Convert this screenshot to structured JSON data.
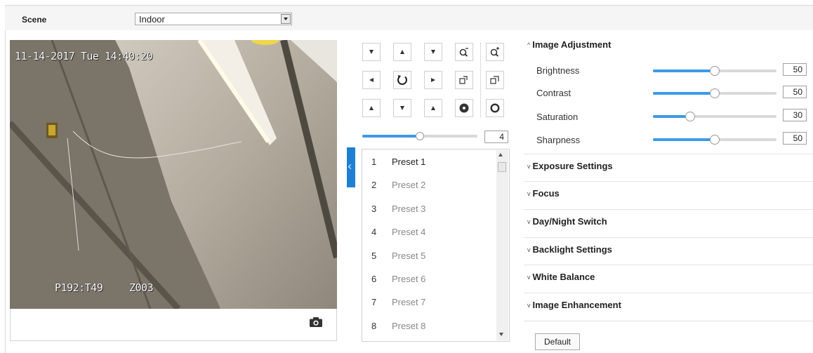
{
  "scene": {
    "label": "Scene",
    "value": "Indoor"
  },
  "video": {
    "timestamp": "11-14-2017 Tue 14:40:20",
    "ptz_readout": "P192:T49",
    "zoom_readout": "Z003"
  },
  "icons": {
    "snapshot": "camera-icon",
    "collapse": "chevron-left-icon"
  },
  "ptz": {
    "speed_value": "4",
    "speed_fraction": 0.5
  },
  "presets": [
    {
      "num": "1",
      "name": "Preset 1"
    },
    {
      "num": "2",
      "name": "Preset 2"
    },
    {
      "num": "3",
      "name": "Preset 3"
    },
    {
      "num": "4",
      "name": "Preset 4"
    },
    {
      "num": "5",
      "name": "Preset 5"
    },
    {
      "num": "6",
      "name": "Preset 6"
    },
    {
      "num": "7",
      "name": "Preset 7"
    },
    {
      "num": "8",
      "name": "Preset 8"
    }
  ],
  "image_adjustment": {
    "title": "Image Adjustment",
    "items": [
      {
        "label": "Brightness",
        "value": "50"
      },
      {
        "label": "Contrast",
        "value": "50"
      },
      {
        "label": "Saturation",
        "value": "30"
      },
      {
        "label": "Sharpness",
        "value": "50"
      }
    ]
  },
  "sections": [
    "Exposure Settings",
    "Focus",
    "Day/Night Switch",
    "Backlight Settings",
    "White Balance",
    "Image Enhancement"
  ],
  "default_button": "Default",
  "colors": {
    "accent": "#1e7fd2",
    "slider_fill": "#3d9ae8"
  }
}
